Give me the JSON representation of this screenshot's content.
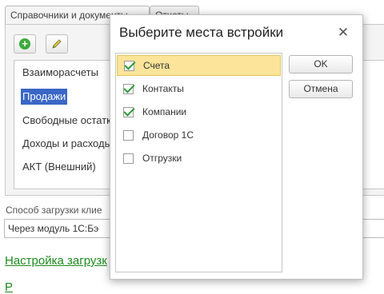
{
  "tabs": [
    {
      "label": "Справочники и документы"
    },
    {
      "label": "Отчеты"
    }
  ],
  "toolbar": {
    "add_icon": "add-circle-icon",
    "edit_icon": "pencil-icon",
    "add_color": "#3caa3c"
  },
  "list": {
    "items": [
      {
        "label": "Взаиморасчеты"
      },
      {
        "label": "Продажи",
        "selected": true
      },
      {
        "label": "Свободные остатк"
      },
      {
        "label": "Доходы и расходы"
      },
      {
        "label": "АКТ (Внешний)"
      }
    ],
    "selected_color": "#3a66c6"
  },
  "load_mode": {
    "label": "Способ загрузки клие",
    "value": "Через модуль 1С:Бэ"
  },
  "links": {
    "settings": "Настройка загрузк",
    "next": "Р"
  },
  "dialog": {
    "title": "Выберите места встройки",
    "close_icon": "close-icon",
    "options": [
      {
        "label": "Счета",
        "checked": true,
        "current": true
      },
      {
        "label": "Контакты",
        "checked": true
      },
      {
        "label": "Компании",
        "checked": true
      },
      {
        "label": "Договор 1С",
        "checked": false
      },
      {
        "label": "Отгрузки",
        "checked": false
      }
    ],
    "ok_label": "OK",
    "cancel_label": "Отмена",
    "highlight_color": "#fce49a",
    "check_color": "#2f9a3a"
  },
  "link_color": "#1d8a1d"
}
